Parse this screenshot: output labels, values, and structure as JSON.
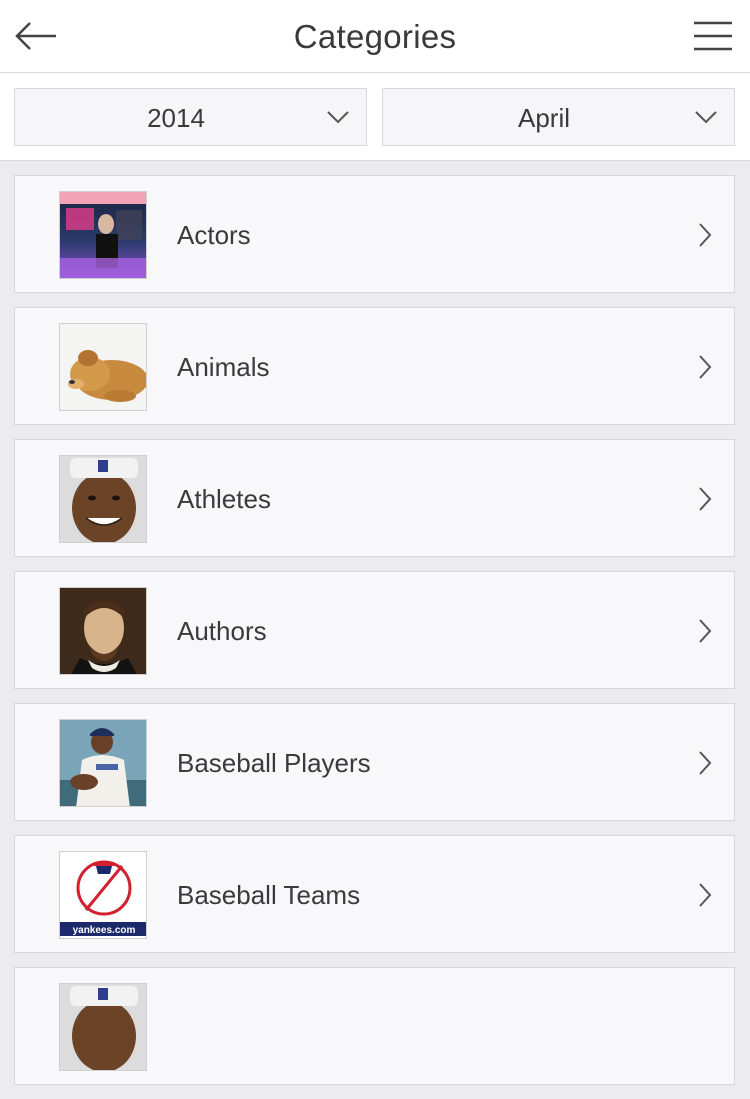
{
  "header": {
    "title": "Categories",
    "back_icon": "arrow-left-icon",
    "menu_icon": "hamburger-menu-icon"
  },
  "filters": {
    "year": "2014",
    "month": "April"
  },
  "categories": [
    {
      "label": "Actors",
      "thumb": "album-cover-photo"
    },
    {
      "label": "Animals",
      "thumb": "sleeping-puppy-photo"
    },
    {
      "label": "Athletes",
      "thumb": "athlete-headband-photo"
    },
    {
      "label": "Authors",
      "thumb": "shakespeare-portrait"
    },
    {
      "label": "Baseball Players",
      "thumb": "baseball-player-photo"
    },
    {
      "label": "Baseball Teams",
      "thumb": "yankees-logo"
    }
  ],
  "thumb_texts": {
    "yankees_caption": "yankees.com"
  },
  "colors": {
    "background": "#ececee",
    "row_background": "#f8f8fa",
    "text": "#3a3a3a"
  }
}
